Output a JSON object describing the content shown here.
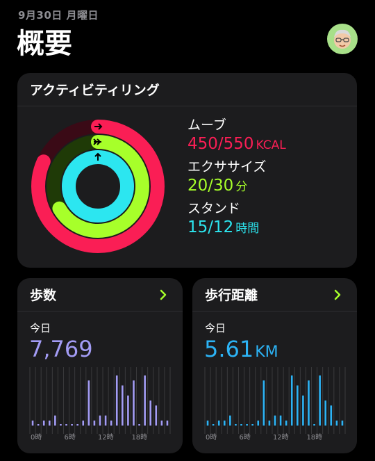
{
  "header": {
    "date": "9月30日 月曜日",
    "title": "概要"
  },
  "activity": {
    "title": "アクティビティリング",
    "move": {
      "label": "ムーブ",
      "value": "450/550",
      "unit": "KCAL",
      "fraction": 0.818
    },
    "exercise": {
      "label": "エクササイズ",
      "value": "20/30",
      "unit": "分",
      "fraction": 0.667
    },
    "stand": {
      "label": "スタンド",
      "value": "15/12",
      "unit": "時間",
      "fraction": 1.25
    }
  },
  "steps": {
    "title": "歩数",
    "today_label": "今日",
    "value": "7,769",
    "color": "#a39cf5",
    "hourly": [
      1,
      0,
      1,
      1,
      2,
      0,
      0,
      0,
      0,
      1,
      9,
      1,
      2,
      2,
      1,
      10,
      8,
      6,
      9,
      0,
      10,
      5,
      4,
      1,
      1
    ],
    "axis": [
      "0時",
      "6時",
      "12時",
      "18時"
    ]
  },
  "distance": {
    "title": "歩行距離",
    "today_label": "今日",
    "value": "5.61",
    "unit": "KM",
    "color": "#2cb3f5",
    "hourly": [
      1,
      0,
      1,
      1,
      2,
      0,
      0,
      0,
      0,
      1,
      9,
      1,
      2,
      2,
      1,
      10,
      8,
      6,
      9,
      0,
      10,
      5,
      4,
      1,
      1
    ],
    "axis": [
      "0時",
      "6時",
      "12時",
      "18時"
    ]
  },
  "colors": {
    "move": "#fa1e55",
    "exercise": "#a7ff2a",
    "stand": "#2ce6f0",
    "chevron": "#a7ff2a"
  }
}
